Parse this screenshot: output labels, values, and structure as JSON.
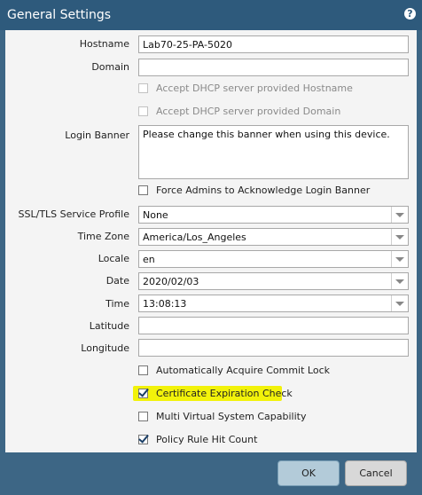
{
  "dialog": {
    "title": "General Settings",
    "help_icon": "?"
  },
  "fields": {
    "hostname": {
      "label": "Hostname",
      "value": "Lab70-25-PA-5020"
    },
    "domain": {
      "label": "Domain",
      "value": ""
    },
    "accept_dhcp_hostname": {
      "label": "Accept DHCP server provided Hostname",
      "checked": false,
      "disabled": true
    },
    "accept_dhcp_domain": {
      "label": "Accept DHCP server provided Domain",
      "checked": false,
      "disabled": true
    },
    "login_banner": {
      "label": "Login Banner",
      "value": "Please change this banner when using this device."
    },
    "force_admins": {
      "label": "Force Admins to Acknowledge Login Banner",
      "checked": false
    },
    "ssl_tls_profile": {
      "label": "SSL/TLS Service Profile",
      "value": "None"
    },
    "time_zone": {
      "label": "Time Zone",
      "value": "America/Los_Angeles"
    },
    "locale": {
      "label": "Locale",
      "value": "en"
    },
    "date": {
      "label": "Date",
      "value": "2020/02/03"
    },
    "time": {
      "label": "Time",
      "value": "13:08:13"
    },
    "latitude": {
      "label": "Latitude",
      "value": ""
    },
    "longitude": {
      "label": "Longitude",
      "value": ""
    },
    "auto_commit_lock": {
      "label": "Automatically Acquire Commit Lock",
      "checked": false
    },
    "cert_expiration_check": {
      "label": "Certificate Expiration Check",
      "checked": true,
      "highlighted": true
    },
    "multi_vsys": {
      "label": "Multi Virtual System Capability",
      "checked": false
    },
    "policy_rule_hit_count": {
      "label": "Policy Rule Hit Count",
      "checked": true
    }
  },
  "buttons": {
    "ok": "OK",
    "cancel": "Cancel"
  },
  "colors": {
    "title_bar": "#2e5a7c",
    "frame": "#3d6685",
    "highlight": "#f2f20a",
    "ok_button": "#b3cbd9",
    "cancel_button": "#d8d8d8"
  }
}
